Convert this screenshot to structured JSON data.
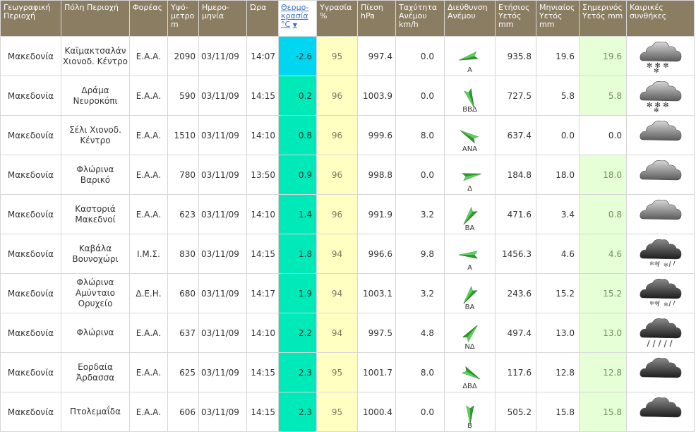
{
  "headers": {
    "region": "Γεωγραφική Περιοχή",
    "city": "Πόλη Περιοχή",
    "operator": "Φορέας",
    "altitude": "Υψό- μετρο m",
    "date": "Ημερο- μηνία",
    "time": "Ώρα",
    "temperature": "Θερμο- κρασία °C",
    "humidity": "Υγρασία %",
    "pressure": "Πίεση hPa",
    "wind_speed": "Ταχύτητα Ανέμου km/h",
    "wind_direction": "Διεύθυνση Ανέμου",
    "yearly_rain": "Ετήσιος Υετός mm",
    "monthly_rain": "Μηνιαίος Υετός mm",
    "today_rain": "Σημερινός Υετός mm",
    "conditions": "Καιρικές συνθήκες"
  },
  "sort_indicator": "▼",
  "colors": {
    "header_bg": "#8a7d62",
    "temp_bg": "#00e9b8",
    "temp_cold_bg": "#00d6ef",
    "humidity_bg": "#ffffc2",
    "today_rain_bg": "#e6ffd6",
    "arrow": "#2a9d2a"
  },
  "rows": [
    {
      "region": "Μακεδονία",
      "city": "Καϊμακτσαλάν Χιονοδ. Κέντρο",
      "operator": "Ε.Α.Α.",
      "altitude": "2090",
      "date": "03/11/09",
      "time": "14:07",
      "temp": "-2.6",
      "humidity": "95",
      "pressure": "997.4",
      "wind_speed": "0.0",
      "wind_dir": "Α",
      "wind_deg": 255,
      "yearly": "935.8",
      "monthly": "19.6",
      "today": "19.6",
      "icon": "snow-cloud-icon"
    },
    {
      "region": "Μακεδονία",
      "city": "Δράμα Νευροκόπι",
      "operator": "Ε.Α.Α.",
      "altitude": "590",
      "date": "03/11/09",
      "time": "14:15",
      "temp": "0.2",
      "humidity": "96",
      "pressure": "1003.9",
      "wind_speed": "0.0",
      "wind_dir": "ΒΒΔ",
      "wind_deg": 160,
      "yearly": "727.5",
      "monthly": "5.8",
      "today": "5.8",
      "icon": "snow-cloud-icon"
    },
    {
      "region": "Μακεδονία",
      "city": "Σέλι Χιονοδ. Κέντρο",
      "operator": "Ε.Α.Α.",
      "altitude": "1510",
      "date": "03/11/09",
      "time": "14:10",
      "temp": "0.8",
      "humidity": "96",
      "pressure": "999.6",
      "wind_speed": "8.0",
      "wind_dir": "ΑΝΑ",
      "wind_deg": 300,
      "yearly": "637.4",
      "monthly": "0.0",
      "today": "0.0",
      "icon": "cloud-icon"
    },
    {
      "region": "Μακεδονία",
      "city": "Φλώρινα Βαρικό",
      "operator": "Ε.Α.Α.",
      "altitude": "780",
      "date": "03/11/09",
      "time": "13:50",
      "temp": "0.9",
      "humidity": "96",
      "pressure": "998.8",
      "wind_speed": "0.0",
      "wind_dir": "Δ",
      "wind_deg": 80,
      "yearly": "184.8",
      "monthly": "18.0",
      "today": "18.0",
      "icon": "cloud-icon"
    },
    {
      "region": "Μακεδονία",
      "city": "Καστοριά Μακεδνοί",
      "operator": "Ε.Α.Α.",
      "altitude": "623",
      "date": "03/11/09",
      "time": "14:10",
      "temp": "1.4",
      "humidity": "96",
      "pressure": "991.9",
      "wind_speed": "3.2",
      "wind_dir": "ΒΑ",
      "wind_deg": 215,
      "yearly": "471.6",
      "monthly": "3.4",
      "today": "0.8",
      "icon": "cloud-icon"
    },
    {
      "region": "Μακεδονία",
      "city": "Καβάλα Βουνοχώρι",
      "operator": "Ι.Μ.Σ.",
      "altitude": "830",
      "date": "03/11/09",
      "time": "14:15",
      "temp": "1.8",
      "humidity": "94",
      "pressure": "996.6",
      "wind_speed": "9.8",
      "wind_dir": "Α",
      "wind_deg": 270,
      "yearly": "1456.3",
      "monthly": "4.6",
      "today": "4.6",
      "icon": "sleet-cloud-icon"
    },
    {
      "region": "Μακεδονία",
      "city": "Φλώρινα Αμύνταιο Ορυχείο",
      "operator": "Δ.Ε.Η.",
      "altitude": "680",
      "date": "03/11/09",
      "time": "14:17",
      "temp": "1.9",
      "humidity": "94",
      "pressure": "1003.1",
      "wind_speed": "3.2",
      "wind_dir": "ΒΑ",
      "wind_deg": 215,
      "yearly": "243.6",
      "monthly": "15.2",
      "today": "15.2",
      "icon": "sleet-cloud-icon"
    },
    {
      "region": "Μακεδονία",
      "city": "Φλώρινα",
      "operator": "Ε.Α.Α.",
      "altitude": "637",
      "date": "03/11/09",
      "time": "14:10",
      "temp": "2.2",
      "humidity": "94",
      "pressure": "997.5",
      "wind_speed": "4.8",
      "wind_dir": "ΝΔ",
      "wind_deg": 40,
      "yearly": "497.4",
      "monthly": "13.0",
      "today": "13.0",
      "icon": "rain-cloud-icon"
    },
    {
      "region": "Μακεδονία",
      "city": "Εορδαία Άρδασσα",
      "operator": "Ε.Α.Α.",
      "altitude": "625",
      "date": "03/11/09",
      "time": "14:15",
      "temp": "2.3",
      "humidity": "95",
      "pressure": "1001.7",
      "wind_speed": "8.0",
      "wind_dir": "ΔΒΔ",
      "wind_deg": 120,
      "yearly": "117.6",
      "monthly": "12.8",
      "today": "12.8",
      "icon": "dark-cloud-icon"
    },
    {
      "region": "Μακεδονία",
      "city": "Πτολεμαΐδα",
      "operator": "Ε.Α.Α.",
      "altitude": "606",
      "date": "03/11/09",
      "time": "14:15",
      "temp": "2.3",
      "humidity": "95",
      "pressure": "1000.4",
      "wind_speed": "0.0",
      "wind_dir": "Β",
      "wind_deg": 180,
      "yearly": "505.2",
      "monthly": "15.8",
      "today": "15.8",
      "icon": "dark-cloud-icon"
    }
  ]
}
